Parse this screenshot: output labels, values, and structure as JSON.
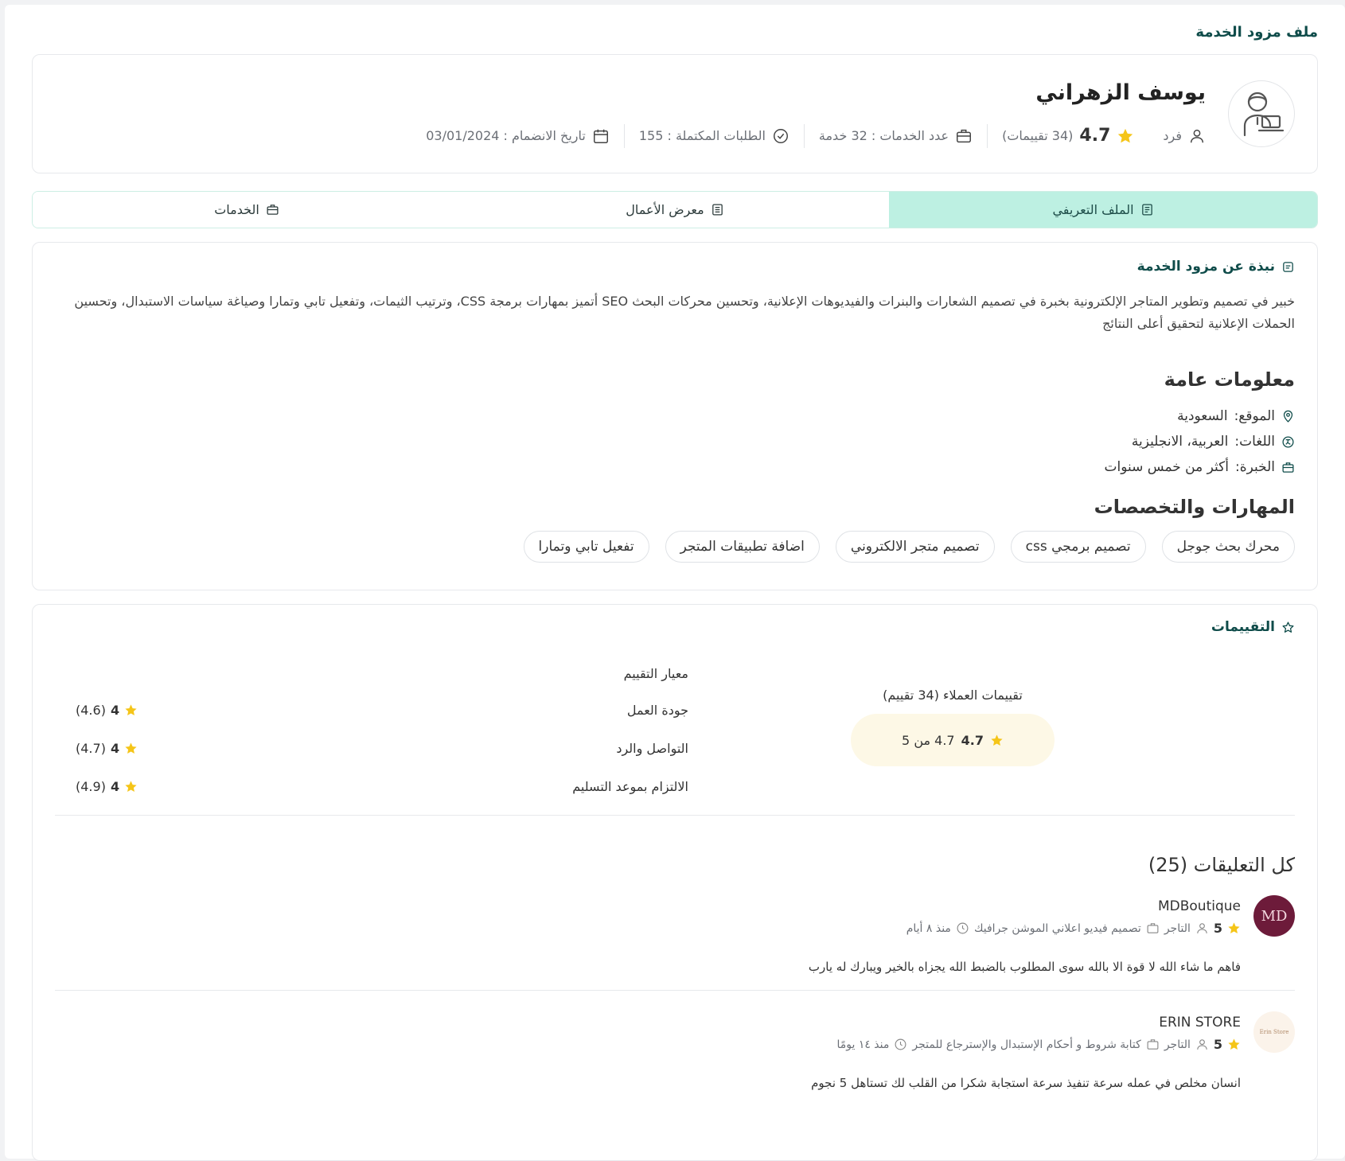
{
  "page": {
    "title": "ملف مزود الخدمة"
  },
  "profile": {
    "name": "يوسف الزهراني",
    "type": "فرد",
    "rating": "4.7",
    "reviews_count": "(34 تقييمات)",
    "services_count": "عدد الخدمات : 32 خدمة",
    "completed_orders": "الطلبات المكتملة : 155",
    "join_date": "تاريخ الانضمام : 03/01/2024"
  },
  "tabs": [
    {
      "label": "الملف التعريفي",
      "active": true
    },
    {
      "label": "معرض الأعمال",
      "active": false
    },
    {
      "label": "الخدمات",
      "active": false
    }
  ],
  "about": {
    "heading": "نبذة عن مزود الخدمة",
    "bio": "خبير في تصميم وتطوير المتاجر الإلكترونية بخبرة في تصميم الشعارات والبنرات والفيديوهات الإعلانية، وتحسين محركات البحث SEO أتميز بمهارات برمجة CSS، وترتيب الثيمات، وتفعيل تابي وتمارا وصياغة سياسات الاستبدال، وتحسين الحملات الإعلانية لتحقيق أعلى النتائج",
    "general_heading": "معلومات عامة",
    "location_label": "الموقع:",
    "location_value": "السعودية",
    "languages_label": "اللغات:",
    "languages_value": "العربية، الانجليزية",
    "experience_label": "الخبرة:",
    "experience_value": "أكثر من خمس سنوات",
    "skills_heading": "المهارات والتخصصات",
    "skills": [
      "محرك بحث جوجل",
      "تصميم برمجي css",
      "تصميم متجر الالكتروني",
      "اضافة تطبيقات المتجر",
      "تفعيل تابي وتمارا"
    ]
  },
  "reviews": {
    "heading": "التقييمات",
    "criteria_heading": "معيار التقييم",
    "criteria": [
      {
        "label": "جودة العمل",
        "stars": "4",
        "score": "(4.6)"
      },
      {
        "label": "التواصل والرد",
        "stars": "4",
        "score": "(4.7)"
      },
      {
        "label": "الالتزام بموعد التسليم",
        "stars": "4",
        "score": "(4.9)"
      }
    ],
    "overall_title": "تقييمات العملاء (34 تقييم)",
    "overall_rating": "4.7",
    "overall_text": "4.7 من 5",
    "comments_title": "كل التعليقات (25)",
    "comments": [
      {
        "name": "MDBoutique",
        "avatar_text": "MD",
        "stars": "5",
        "role": "التاجر",
        "service": "تصميم فيديو اعلاني الموشن جرافيك",
        "time": "منذ ٨ أيام",
        "text": "فاهم ما شاء الله لا قوة الا بالله سوى المطلوب بالضبط الله يجزاه بالخير ويبارك له يارب"
      },
      {
        "name": "ERIN STORE",
        "avatar_text": "Erin Store",
        "stars": "5",
        "role": "التاجر",
        "service": "كتابة شروط و أحكام الإستبدال والإسترجاع للمتجر",
        "time": "منذ ١٤ يومًا",
        "text": "انسان مخلص في عمله سرعة تنفيذ سرعة استجابة شكرا من القلب لك تستاهل 5 نجوم"
      }
    ]
  },
  "colors": {
    "accent": "#0f4c4a",
    "tab_active": "#bdf0e2",
    "star": "#f5c518",
    "pill": "#fdf8e6"
  }
}
